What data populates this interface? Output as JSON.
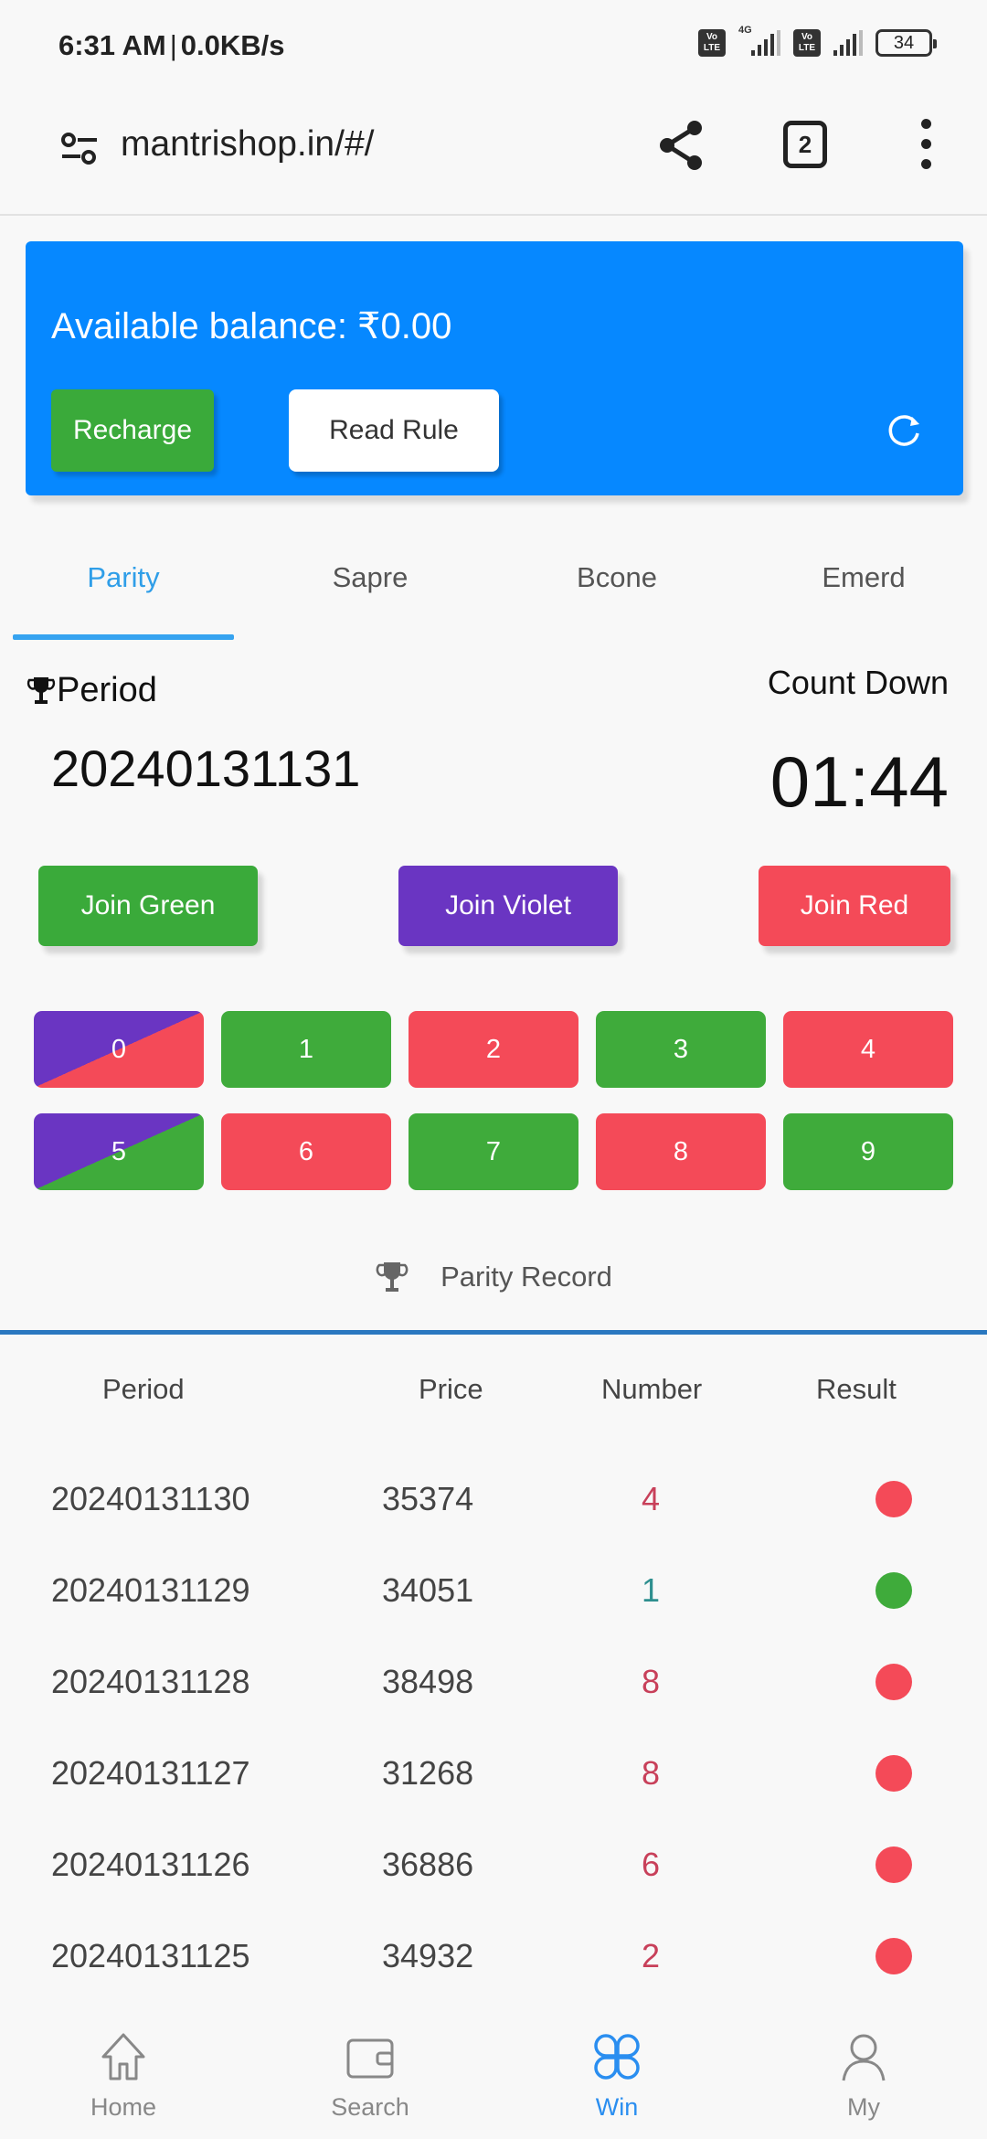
{
  "status_bar": {
    "time": "6:31 AM",
    "speed": "0.0KB/s",
    "network_label": "4G",
    "volte_label_top": "Vo",
    "volte_label_bottom": "LTE",
    "battery": "34"
  },
  "browser": {
    "url": "mantrishop.in/#/",
    "tab_count": "2"
  },
  "balance_card": {
    "balance_text": "Available balance: ₹0.00",
    "recharge_label": "Recharge",
    "read_rule_label": "Read Rule"
  },
  "game_tabs": [
    {
      "label": "Parity",
      "active": true
    },
    {
      "label": "Sapre",
      "active": false
    },
    {
      "label": "Bcone",
      "active": false
    },
    {
      "label": "Emerd",
      "active": false
    }
  ],
  "period": {
    "label": "Period",
    "value": "20240131131",
    "countdown_label": "Count Down",
    "countdown_value": "01:44"
  },
  "join_buttons": {
    "green": "Join Green",
    "violet": "Join Violet",
    "red": "Join Red"
  },
  "numbers": [
    {
      "n": "0",
      "color": "violet-red"
    },
    {
      "n": "1",
      "color": "green"
    },
    {
      "n": "2",
      "color": "red"
    },
    {
      "n": "3",
      "color": "green"
    },
    {
      "n": "4",
      "color": "red"
    },
    {
      "n": "5",
      "color": "violet-green"
    },
    {
      "n": "6",
      "color": "red"
    },
    {
      "n": "7",
      "color": "green"
    },
    {
      "n": "8",
      "color": "red"
    },
    {
      "n": "9",
      "color": "green"
    }
  ],
  "record": {
    "title": "Parity Record",
    "headers": [
      "Period",
      "Price",
      "Number",
      "Result"
    ],
    "rows": [
      {
        "period": "20240131130",
        "price": "35374",
        "number": "4",
        "result": "red"
      },
      {
        "period": "20240131129",
        "price": "34051",
        "number": "1",
        "result": "green"
      },
      {
        "period": "20240131128",
        "price": "38498",
        "number": "8",
        "result": "red"
      },
      {
        "period": "20240131127",
        "price": "31268",
        "number": "8",
        "result": "red"
      },
      {
        "period": "20240131126",
        "price": "36886",
        "number": "6",
        "result": "red"
      },
      {
        "period": "20240131125",
        "price": "34932",
        "number": "2",
        "result": "red"
      }
    ]
  },
  "colors": {
    "blue": "#0688ff",
    "green": "#3fab3b",
    "red": "#f44a58",
    "violet": "#6a35c2",
    "number_red": "#c8405a",
    "number_green": "#2e8f8f",
    "active_tab": "#2f9ee8"
  },
  "bottom_nav": [
    {
      "label": "Home",
      "active": false
    },
    {
      "label": "Search",
      "active": false
    },
    {
      "label": "Win",
      "active": true
    },
    {
      "label": "My",
      "active": false
    }
  ]
}
